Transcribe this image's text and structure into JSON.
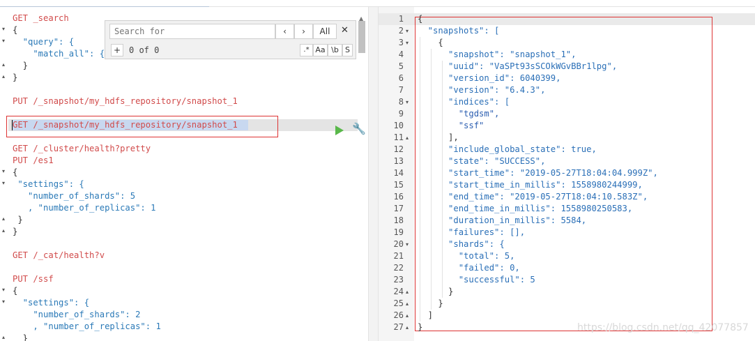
{
  "search": {
    "placeholder": "Search for",
    "prev_label": "‹",
    "next_label": "›",
    "all_label": "All",
    "close_label": "✕",
    "add_label": "+",
    "count_label": "0 of 0",
    "regex_label": ".*",
    "case_label": "Aa",
    "word_label": "\\b",
    "selection_label": "S"
  },
  "left_lines": [
    "GET _search",
    "{",
    "  \"query\": {",
    "    \"match_all\": {}",
    "  }",
    "}",
    "",
    "PUT /_snapshot/my_hdfs_repository/snapshot_1",
    "",
    "GET /_snapshot/my_hdfs_repository/snapshot_1",
    "",
    "GET /_cluster/health?pretty",
    "PUT /es1",
    "{",
    " \"settings\": {",
    "   \"number_of_shards\": 5",
    "   , \"number_of_replicas\": 1",
    " }",
    "}",
    "",
    "GET /_cat/health?v",
    "",
    "PUT /ssf",
    "{",
    "  \"settings\": {",
    "    \"number_of_shards\": 2",
    "    , \"number_of_replicas\": 1",
    "  }"
  ],
  "right_lines": [
    "{",
    "  \"snapshots\": [",
    "    {",
    "      \"snapshot\": \"snapshot_1\",",
    "      \"uuid\": \"VaSPt93sSCOkWGvBBr1lpg\",",
    "      \"version_id\": 6040399,",
    "      \"version\": \"6.4.3\",",
    "      \"indices\": [",
    "        \"tgdsm\",",
    "        \"ssf\"",
    "      ],",
    "      \"include_global_state\": true,",
    "      \"state\": \"SUCCESS\",",
    "      \"start_time\": \"2019-05-27T18:04:04.999Z\",",
    "      \"start_time_in_millis\": 1558980244999,",
    "      \"end_time\": \"2019-05-27T18:04:10.583Z\",",
    "      \"end_time_in_millis\": 1558980250583,",
    "      \"duration_in_millis\": 5584,",
    "      \"failures\": [],",
    "      \"shards\": {",
    "        \"total\": 5,",
    "        \"failed\": 0,",
    "        \"successful\": 5",
    "      }",
    "    }",
    "  ]",
    "}"
  ],
  "line_numbers": [
    "1",
    "2",
    "3",
    "4",
    "5",
    "6",
    "7",
    "8",
    "9",
    "10",
    "11",
    "12",
    "13",
    "14",
    "15",
    "16",
    "17",
    "18",
    "19",
    "20",
    "21",
    "22",
    "23",
    "24",
    "25",
    "26",
    "27"
  ],
  "watermark": "https://blog.csdn.net/qq_42077857",
  "colors": {
    "method": "#d14b4b",
    "url": "#2a8ab7",
    "key": "#2a79b7",
    "number": "#1a4dbf",
    "highlight_box": "#dd3333",
    "run_button": "#59b84a"
  },
  "icons": {
    "run": "play-triangle",
    "settings": "wrench"
  }
}
